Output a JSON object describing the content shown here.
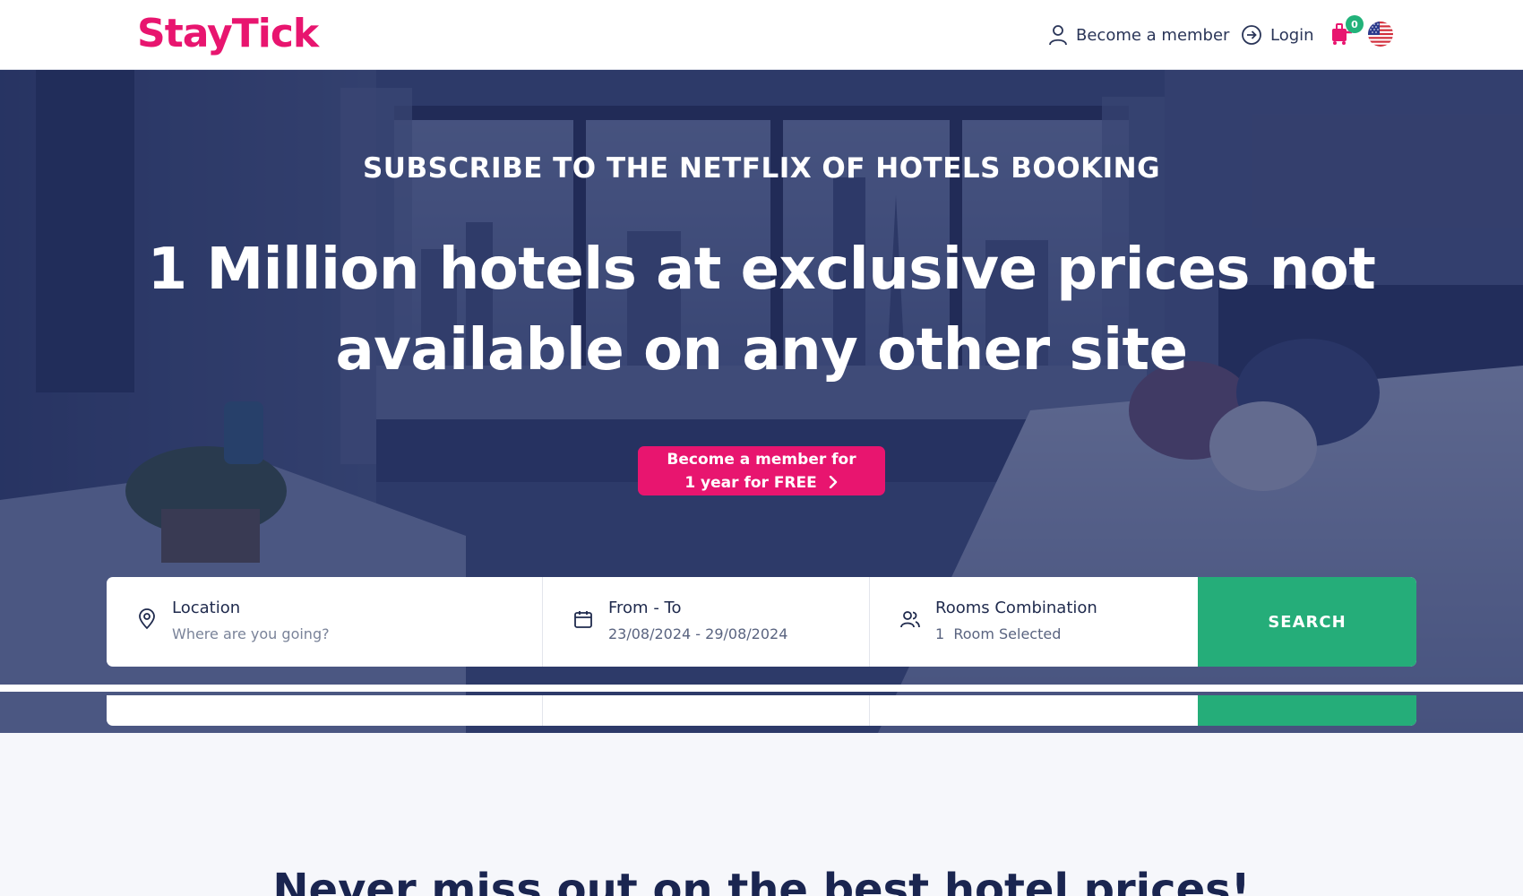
{
  "header": {
    "logo": "StayTick",
    "become_member": "Become a member",
    "login": "Login",
    "cart_count": "0",
    "icons": [
      "user-icon",
      "login-arrow-icon",
      "cart-icon",
      "us-flag-icon"
    ]
  },
  "hero": {
    "subtitle": "SUBSCRIBE TO THE NETFLIX OF HOTELS BOOKING",
    "headline": "1 Million hotels at exclusive prices not available on any other site",
    "cta_line1": "Become a member for",
    "cta_line2": "1 year for FREE"
  },
  "search": {
    "location": {
      "label": "Location",
      "placeholder": "Where are you going?",
      "icon": "map-pin-icon"
    },
    "dates": {
      "label": "From - To",
      "value": "23/08/2024 - 29/08/2024",
      "icon": "calendar-icon"
    },
    "rooms": {
      "label": "Rooms Combination",
      "value": "1  Room Selected",
      "icon": "users-icon"
    },
    "button": "SEARCH"
  },
  "section": {
    "title": "Never miss out on the best hotel prices!"
  },
  "colors": {
    "brand_pink": "#e8156f",
    "search_green": "#25ad79",
    "hero_overlay": "#1c2658",
    "text_dark": "#1f2a4d"
  }
}
